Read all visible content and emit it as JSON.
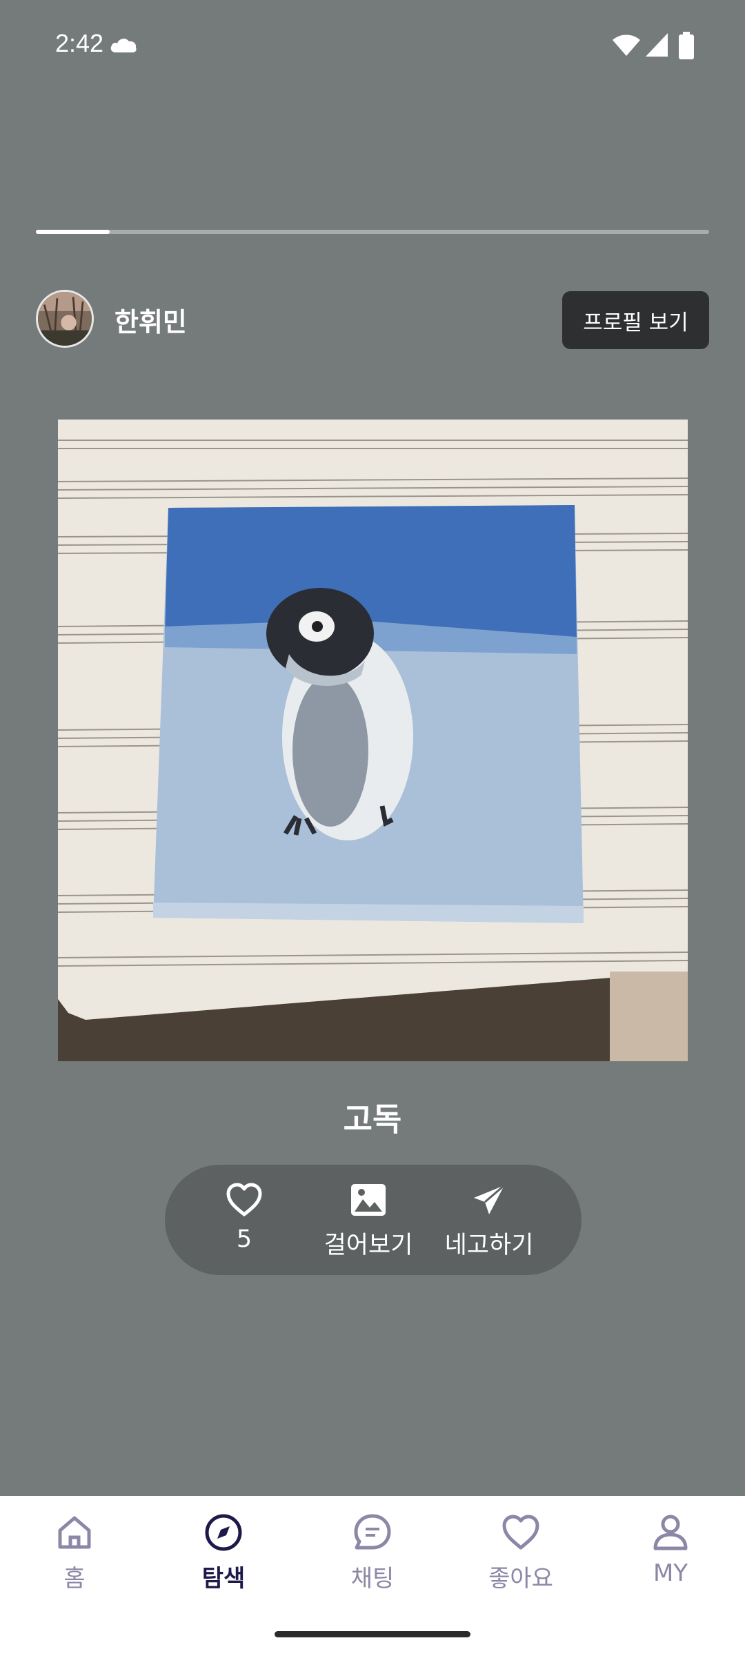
{
  "status_bar": {
    "time": "2:42",
    "icons": [
      "cloud-icon",
      "wifi-icon",
      "signal-icon",
      "battery-icon"
    ]
  },
  "story": {
    "progress": 0.11
  },
  "profile": {
    "name": "한휘민",
    "view_profile_label": "프로필 보기"
  },
  "artwork": {
    "title": "고독"
  },
  "actions": {
    "like_count": "5",
    "hang_label": "걸어보기",
    "share_label": "네고하기"
  },
  "bottom_nav": {
    "items": [
      {
        "label": "홈",
        "icon": "home-icon",
        "active": false
      },
      {
        "label": "탐색",
        "icon": "compass-icon",
        "active": true
      },
      {
        "label": "채팅",
        "icon": "chat-icon",
        "active": false
      },
      {
        "label": "좋아요",
        "icon": "heart-icon",
        "active": false
      },
      {
        "label": "MY",
        "icon": "person-icon",
        "active": false
      }
    ]
  },
  "colors": {
    "background": "#757a7b",
    "nav_active": "#1d1a4a",
    "nav_inactive": "#8c87a6",
    "button_dark": "#2d2f30"
  }
}
